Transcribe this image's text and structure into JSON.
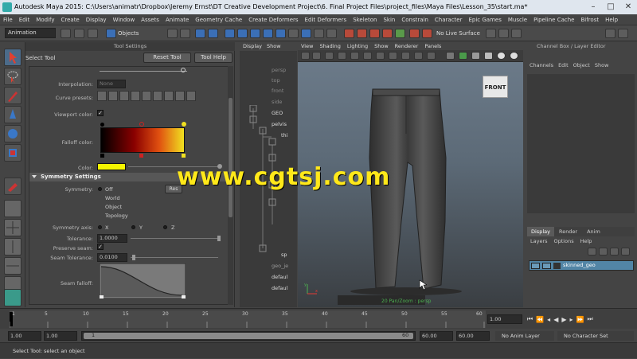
{
  "titlebar": {
    "title": "Autodesk Maya 2015: C:\\Users\\animatr\\Dropbox\\Jeremy Ernst\\DT Creative Development Project\\6. Final Project Files\\project_files\\Maya Files\\Lesson_35\\start.ma*",
    "min": "–",
    "max": "□",
    "close": "✕"
  },
  "menubar": [
    "File",
    "Edit",
    "Modify",
    "Create",
    "Display",
    "Window",
    "Assets",
    "Animate",
    "Geometry Cache",
    "Create Deformers",
    "Edit Deformers",
    "Skeleton",
    "Skin",
    "Constrain",
    "Character",
    "Epic Games",
    "Muscle",
    "Pipeline Cache",
    "Bifrost",
    "Help"
  ],
  "shelf": {
    "mode": "Animation",
    "objects_label": "Objects",
    "live_surface": "No Live Surface"
  },
  "toolsettings": {
    "header": "Tool Settings",
    "tool_name": "Select Tool",
    "reset_btn": "Reset Tool",
    "help_btn": "Tool Help",
    "interpolation_label": "Interpolation:",
    "interpolation_value": "None",
    "curve_presets_label": "Curve presets:",
    "viewport_color_label": "Viewport color:",
    "falloff_color_label": "Falloff color:",
    "color_label": "Color:",
    "symmetry_section": "Symmetry Settings",
    "symmetry_label": "Symmetry:",
    "symmetry_options": [
      "Off",
      "World",
      "Object",
      "Topology"
    ],
    "reset_small": "Res",
    "symmetry_axis_label": "Symmetry axis:",
    "axes": [
      "X",
      "Y",
      "Z"
    ],
    "tolerance_label": "Tolerance:",
    "tolerance_value": "1.0000",
    "preserve_seam_label": "Preserve seam:",
    "seam_tolerance_label": "Seam Tolerance:",
    "seam_tolerance_value": "0.0100",
    "seam_falloff_label": "Seam falloff:"
  },
  "outliner": {
    "menu": [
      "Display",
      "Show"
    ],
    "items": [
      "persp",
      "top",
      "front",
      "side",
      "GEO",
      "pelvis",
      "thi",
      "",
      "",
      "",
      "",
      "",
      "",
      "",
      "sp",
      "geo_je",
      "defaul",
      "defaul"
    ]
  },
  "viewport": {
    "menu": [
      "View",
      "Shading",
      "Lighting",
      "Show",
      "Renderer",
      "Panels"
    ],
    "cube_label": "FRONT",
    "hud": "20 Pan/Zoom : persp",
    "watermark": "www.cgtsj.com"
  },
  "channelbox": {
    "header": "Channel Box / Layer Editor",
    "menu": [
      "Channels",
      "Edit",
      "Object",
      "Show"
    ],
    "tabs": [
      "Display",
      "Render",
      "Anim"
    ],
    "layer_menu": [
      "Layers",
      "Options",
      "Help"
    ],
    "layer_name": "skinned_geo"
  },
  "timeline": {
    "ticks": [
      "1",
      "5",
      "10",
      "15",
      "20",
      "25",
      "30",
      "35",
      "40",
      "45",
      "50",
      "55",
      "60"
    ],
    "current_frame": "1.00"
  },
  "rangebar": {
    "start": "1.00",
    "start2": "1.00",
    "range_start": "1",
    "range_end": "60",
    "end": "60.00",
    "end2": "60.00",
    "anim_layer": "No Anim Layer",
    "character_set": "No Character Set"
  },
  "helpline": {
    "text": "Select Tool: select an object"
  },
  "colors": {
    "accent": "#5285a6",
    "falloff_start": "#000000",
    "falloff_end": "#f0e020",
    "symmetry_color": "#f5f500"
  }
}
